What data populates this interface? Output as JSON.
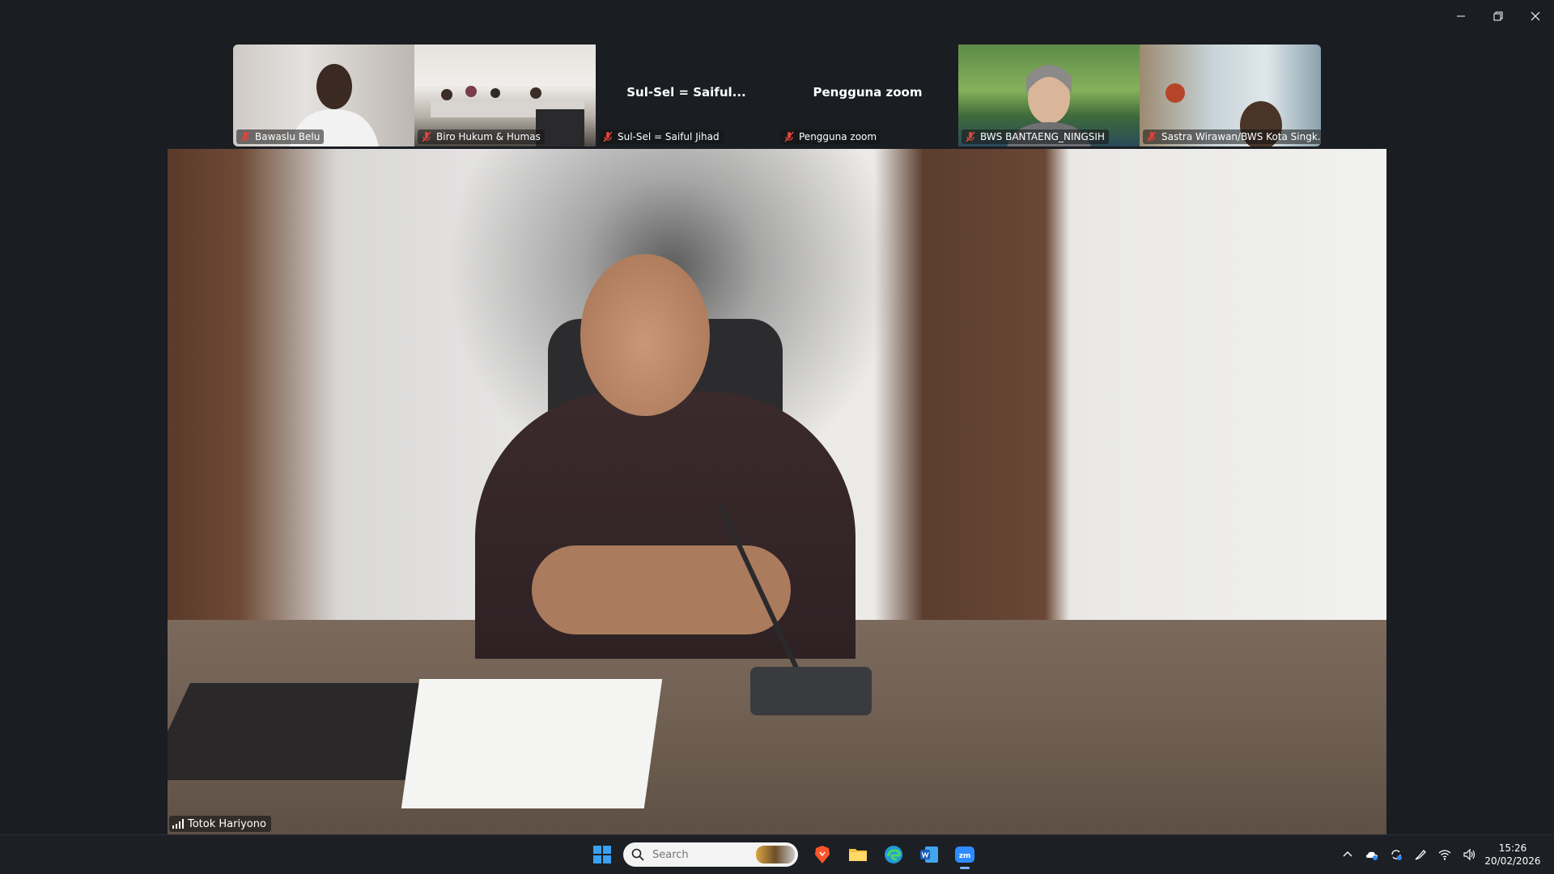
{
  "participants": [
    {
      "name": "Bawaslu Belu",
      "video": true
    },
    {
      "name": "Biro Hukum & Humas",
      "video": true
    },
    {
      "name": "Sul-Sel = Saiful Jihad",
      "display_name": "Sul-Sel = Saiful...",
      "video": false
    },
    {
      "name": "Pengguna zoom",
      "display_name": "Pengguna zoom",
      "video": false
    },
    {
      "name": "BWS BANTAENG_NINGSIH",
      "video": true
    },
    {
      "name": "Sastra Wirawan/BWS Kota Singk...",
      "video": true
    }
  ],
  "active_speaker": {
    "name": "Totok Hariyono"
  },
  "taskbar": {
    "search_placeholder": "Search",
    "clock_time": "15:26",
    "clock_date": "20/02/2026"
  },
  "colors": {
    "mute_red": "#e0443a",
    "taskbar_bg": "#1c1f24",
    "accent": "#7fb4ff"
  }
}
